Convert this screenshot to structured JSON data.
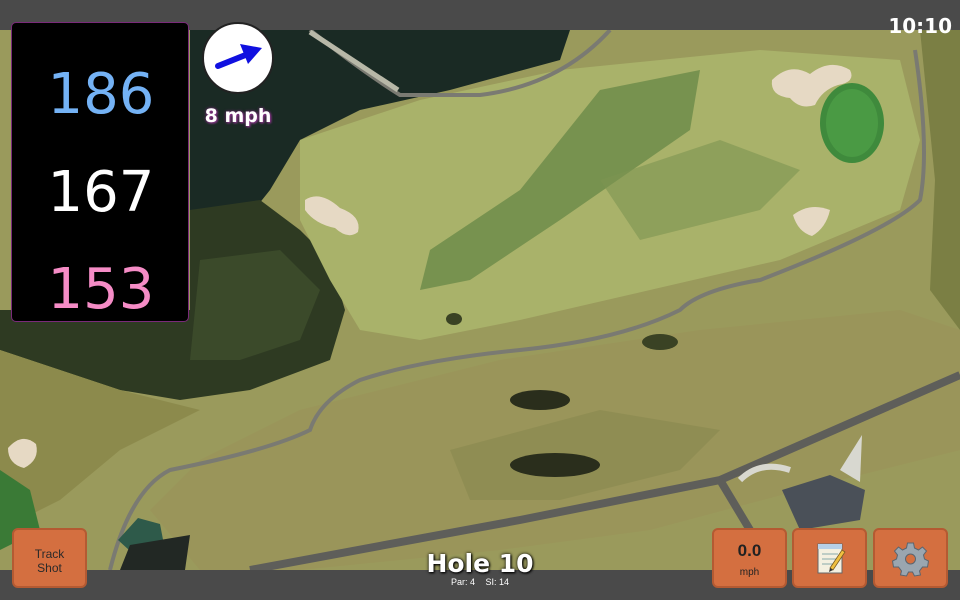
{
  "status_bar": {
    "time": "10:10"
  },
  "distances": {
    "back": "186",
    "middle": "167",
    "front": "153"
  },
  "wind": {
    "speed_text": "8 mph"
  },
  "hole": {
    "title": "Hole 10",
    "par_text": "Par: 4",
    "si_text": "SI: 14"
  },
  "buttons": {
    "track_shot_line1": "Track",
    "track_shot_line2": "Shot",
    "speed_value": "0.0",
    "speed_unit": "mph",
    "notes_icon": "notepad-icon",
    "settings_icon": "gear-icon"
  },
  "colors": {
    "back_distance": "#74b2f5",
    "middle_distance": "#ffffff",
    "front_distance": "#f58cc6",
    "button_accent": "#d46f40",
    "wind_arrow": "#1010e0"
  }
}
